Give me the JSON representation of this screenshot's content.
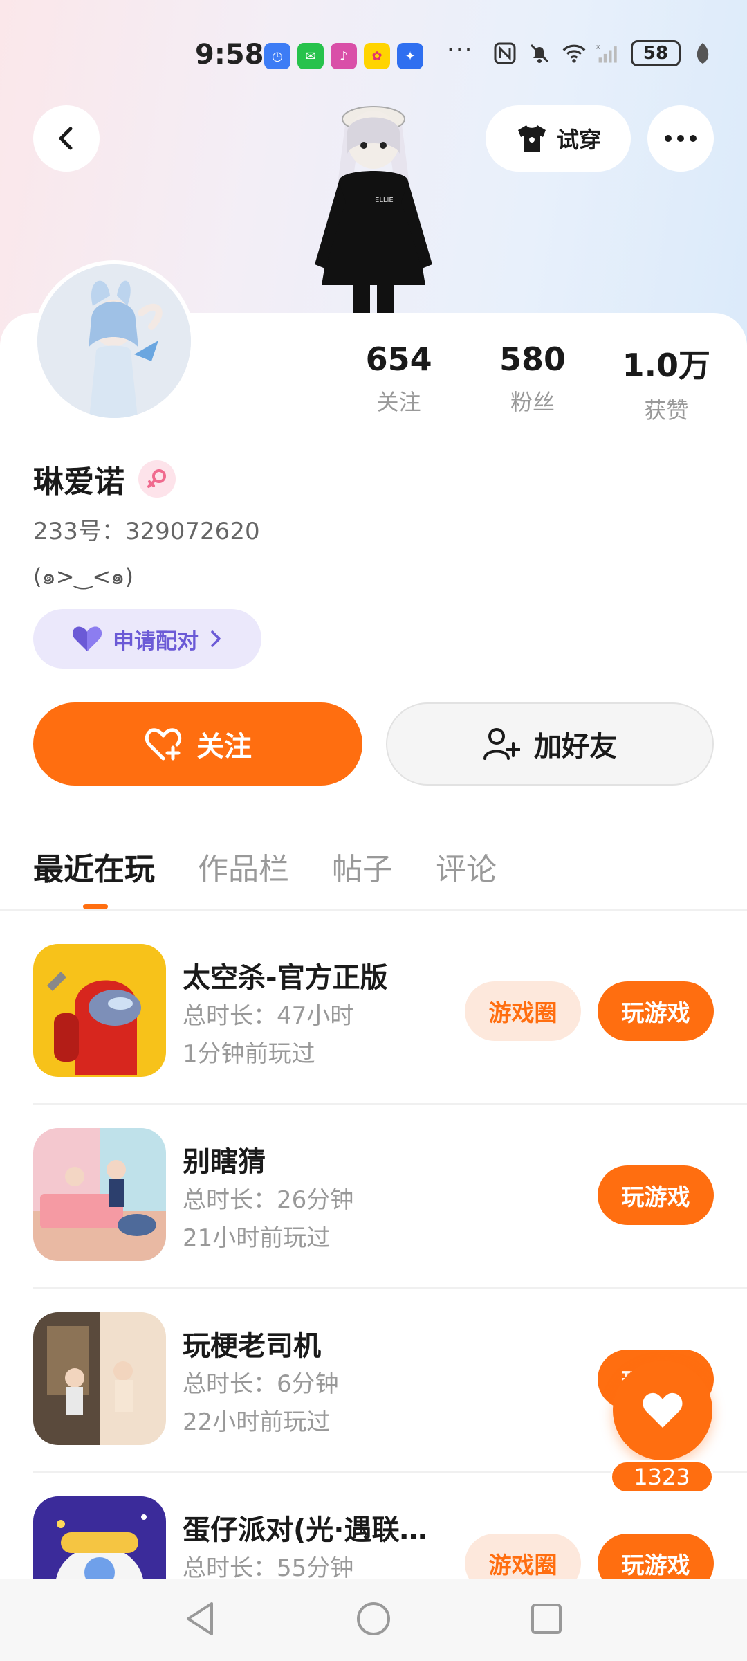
{
  "status_bar": {
    "time": "9:58",
    "more": "···",
    "battery": "58"
  },
  "header": {
    "tryon_label": "试穿"
  },
  "profile": {
    "name": "琳爱诺",
    "uid": "233号：329072620",
    "bio": "(๑>‿<๑)",
    "pair_label": "申请配对",
    "stats": [
      {
        "value": "654",
        "label": "关注"
      },
      {
        "value": "580",
        "label": "粉丝"
      },
      {
        "value": "1.0万",
        "label": "获赞"
      }
    ]
  },
  "actions": {
    "follow_label": "关注",
    "add_friend_label": "加好友"
  },
  "tabs": [
    "最近在玩",
    "作品栏",
    "帖子",
    "评论"
  ],
  "games": [
    {
      "title": "太空杀-官方正版",
      "duration": "总时长：47小时",
      "last_played": "1分钟前玩过",
      "circle": "游戏圈",
      "play": "玩游戏"
    },
    {
      "title": "别瞎猜",
      "duration": "总时长：26分钟",
      "last_played": "21小时前玩过",
      "play": "玩游戏"
    },
    {
      "title": "玩梗老司机",
      "duration": "总时长：6分钟",
      "last_played": "22小时前玩过",
      "play": "玩游戏"
    },
    {
      "title": "蛋仔派对(光·遇联…",
      "duration": "总时长：55分钟",
      "circle": "游戏圈",
      "play": "玩游戏"
    }
  ],
  "like": {
    "count": "1323"
  },
  "colors": {
    "accent": "#ff6e10",
    "pair_purple": "#6b5ad6"
  }
}
